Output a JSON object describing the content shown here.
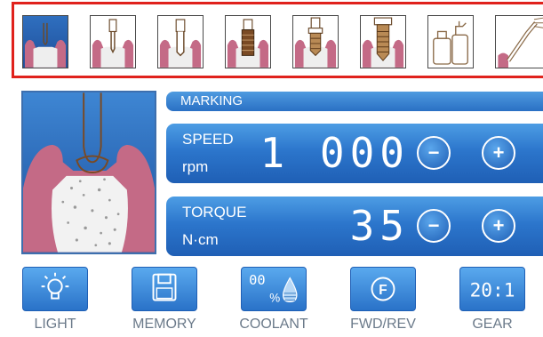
{
  "procedure_steps": [
    {
      "icon": "bone-site-icon",
      "active": true
    },
    {
      "icon": "pilot-drill-icon",
      "active": false
    },
    {
      "icon": "twist-drill-icon",
      "active": false
    },
    {
      "icon": "thread-tap-icon",
      "active": false
    },
    {
      "icon": "implant-placement-icon",
      "active": false
    },
    {
      "icon": "implant-in-bone-icon",
      "active": false
    },
    {
      "icon": "bottles-icon",
      "active": false
    },
    {
      "icon": "irrigation-icon",
      "active": false
    }
  ],
  "marking": {
    "label": "MARKING"
  },
  "speed": {
    "label": "SPEED",
    "unit": "rpm",
    "value": "1 000",
    "minus": "−",
    "plus": "+"
  },
  "torque": {
    "label": "TORQUE",
    "unit": "N·cm",
    "value": "35",
    "minus": "−",
    "plus": "+"
  },
  "buttons": {
    "light": {
      "label": "LIGHT",
      "icon": "light-bulb-icon"
    },
    "memory": {
      "label": "MEMORY",
      "icon": "floppy-disk-icon"
    },
    "coolant": {
      "label": "COOLANT",
      "icon": "coolant-drop-icon",
      "display": "00",
      "unit": "%"
    },
    "fwdrev": {
      "label": "FWD/REV",
      "icon": "forward-icon",
      "display": "F"
    },
    "gear": {
      "label": "GEAR",
      "icon": "gear-ratio-icon",
      "display": "20:1"
    }
  },
  "colors": {
    "accent": "#2c76cc",
    "highlight": "#e0221c",
    "gum": "#c46a86",
    "label_text": "#6b7a8a"
  }
}
